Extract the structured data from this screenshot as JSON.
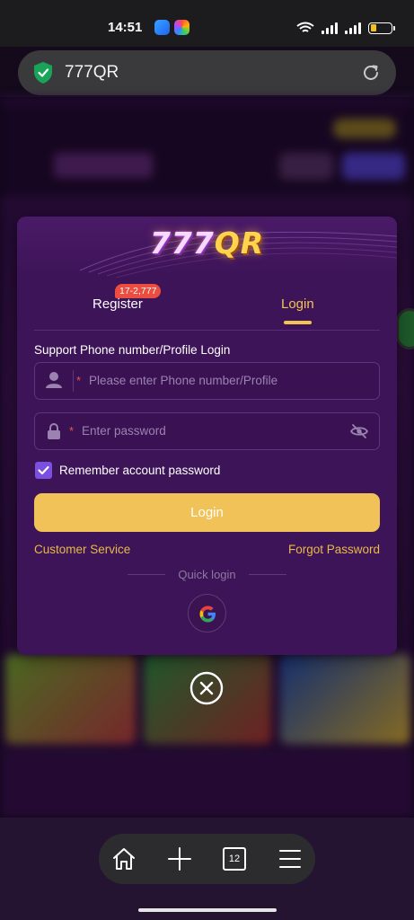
{
  "status_bar": {
    "time": "14:51",
    "app_icons": [
      "blue-app-icon",
      "multicolor-app-icon"
    ],
    "battery_level": 0.28
  },
  "browser": {
    "url": "777QR",
    "open_tabs": "12",
    "icons": [
      "shield-check-icon",
      "reload-icon",
      "home-icon",
      "plus-icon",
      "tabs-icon",
      "menu-icon"
    ]
  },
  "modal": {
    "logo_text": "777",
    "logo_accent": "QR",
    "tabs": {
      "register": "Register",
      "register_badge": "17-2,777",
      "login": "Login",
      "active": "login"
    },
    "form_label": "Support Phone number/Profile Login",
    "phone_field": {
      "required_mark": "*",
      "placeholder": "Please enter Phone number/Profile",
      "value": ""
    },
    "password_field": {
      "required_mark": "*",
      "placeholder": "Enter password",
      "value": ""
    },
    "remember": {
      "label": "Remember account password",
      "checked": true
    },
    "login_button": "Login",
    "customer_service": "Customer Service",
    "forgot_password": "Forgot Password",
    "quick_login": "Quick login",
    "quick_login_providers": [
      "google-icon"
    ]
  },
  "colors": {
    "modal_bg": "#3d1457",
    "accent_gold": "#f0c257",
    "link_gold": "#e9b94a",
    "checkbox": "#7b4fe0",
    "badge_red": "#ec4d3f"
  }
}
